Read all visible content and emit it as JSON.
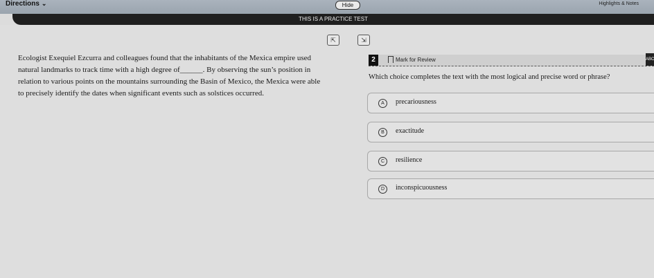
{
  "topbar": {
    "directions_label": "Directions",
    "hide_label": "Hide",
    "tools_label": "Highlights & Notes"
  },
  "banner": {
    "text": "THIS IS A PRACTICE TEST"
  },
  "passage": {
    "before_blank": "Ecologist Exequiel Ezcurra and colleagues found that the inhabitants of the Mexica empire used natural landmarks to track time with a high degree of",
    "blank": "______",
    "after_blank": ". By observing the sun’s position in relation to various points on the mountains surrounding the Basin of Mexico, the Mexica were able to precisely identify the dates when significant events such as solstices occurred."
  },
  "question": {
    "number": "2",
    "mark_label": "Mark for Review",
    "abc_label": "ABC",
    "prompt": "Which choice completes the text with the most logical and precise word or phrase?",
    "choices": [
      {
        "letter": "A",
        "text": "precariousness"
      },
      {
        "letter": "B",
        "text": "exactitude"
      },
      {
        "letter": "C",
        "text": "resilience"
      },
      {
        "letter": "D",
        "text": "inconspicuousness"
      }
    ]
  }
}
